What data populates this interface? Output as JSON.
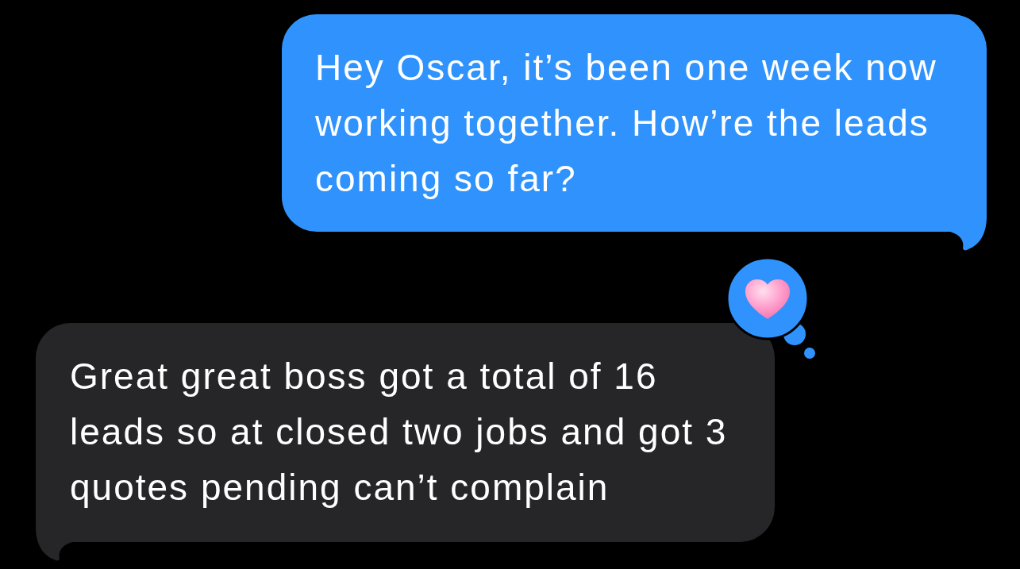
{
  "messages": [
    {
      "kind": "sent",
      "text": "Hey Oscar, it’s been one week now working together. How’re the leads coming so far?",
      "reacted": false
    },
    {
      "kind": "received",
      "text": "Great great boss got a total of 16 leads so at closed two jobs and got 3 quotes pending can’t complain",
      "reacted": true
    }
  ]
}
